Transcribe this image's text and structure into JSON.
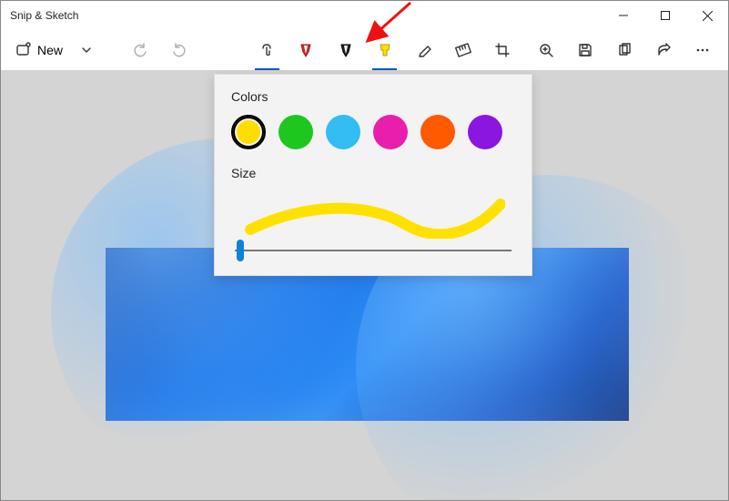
{
  "window": {
    "title": "Snip & Sketch"
  },
  "toolbar": {
    "new_label": "New"
  },
  "popup": {
    "colors_label": "Colors",
    "size_label": "Size",
    "colors": [
      {
        "hex": "#ffdd00",
        "selected": true
      },
      {
        "hex": "#1ec71e",
        "selected": false
      },
      {
        "hex": "#33bdf2",
        "selected": false
      },
      {
        "hex": "#e91ead",
        "selected": false
      },
      {
        "hex": "#ff5a00",
        "selected": false
      },
      {
        "hex": "#8a16e0",
        "selected": false
      }
    ],
    "preview_color": "#ffe100",
    "slider_position_pct": 2
  }
}
